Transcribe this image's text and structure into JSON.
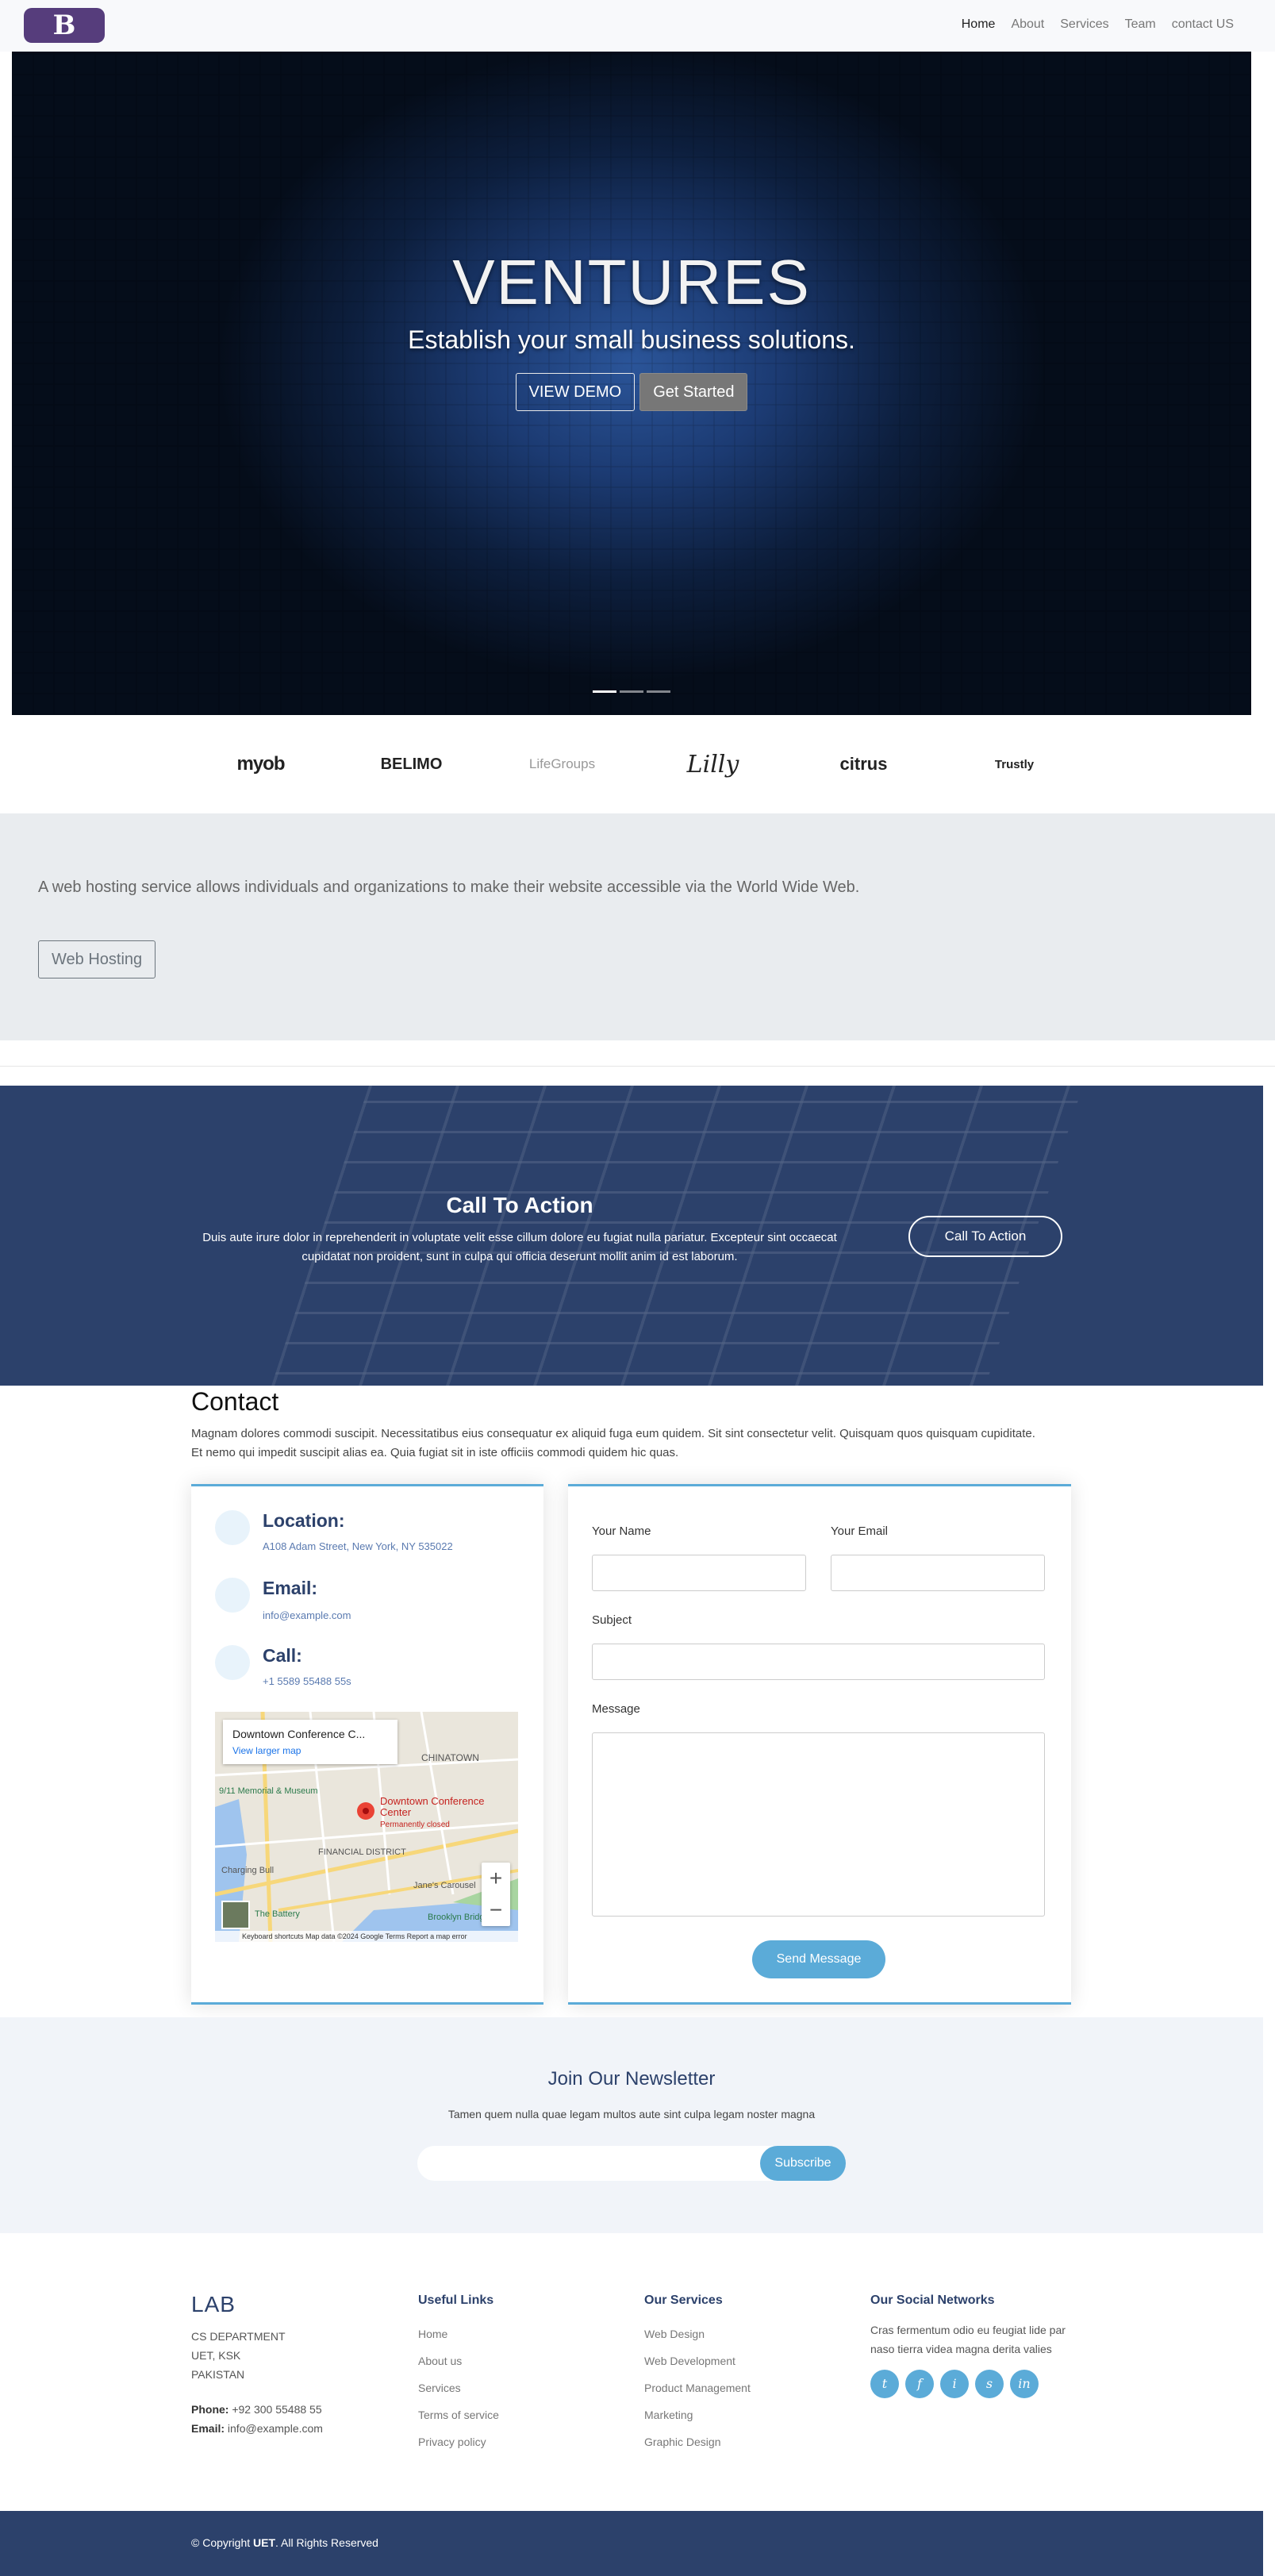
{
  "navbar": {
    "brand_letter": "B",
    "links": [
      "Home",
      "About",
      "Services",
      "Team",
      "contact US"
    ]
  },
  "hero": {
    "title": "VENTURES",
    "subtitle": "Establish your small business solutions.",
    "demo_button": "VIEW DEMO",
    "start_button": "Get Started",
    "slides": 3,
    "active_slide": 1
  },
  "clients": [
    "myob",
    "BELIMO",
    "LifeGroups",
    "Lilly",
    "citrus",
    "Trustly"
  ],
  "hosting": {
    "text": "A web hosting service allows individuals and organizations to make their website accessible via the World Wide Web.",
    "button": "Web Hosting"
  },
  "cta": {
    "title": "Call To Action",
    "text": "Duis aute irure dolor in reprehenderit in voluptate velit esse cillum dolore eu fugiat nulla pariatur. Excepteur sint occaecat cupidatat non proident, sunt in culpa qui officia deserunt mollit anim id est laborum.",
    "button": "Call To Action"
  },
  "contact": {
    "title": "Contact",
    "text": "Magnam dolores commodi suscipit. Necessitatibus eius consequatur ex aliquid fuga eum quidem. Sit sint consectetur velit. Quisquam quos quisquam cupiditate. Et nemo qui impedit suscipit alias ea. Quia fugiat sit in iste officiis commodi quidem hic quas.",
    "location_label": "Location:",
    "location_value": "A108 Adam Street, New York, NY 535022",
    "email_label": "Email:",
    "email_value": "info@example.com",
    "call_label": "Call:",
    "call_value": "+1 5589 55488 55s",
    "map": {
      "place_title": "Downtown Conference C...",
      "larger_map_link": "View larger map",
      "pin_label": "Downtown Conference Center",
      "pin_status": "Permanently closed",
      "area_labels": [
        "CHINATOWN",
        "FINANCIAL DISTRICT",
        "9/11 Memorial & Museum",
        "Charging Bull",
        "The Battery",
        "Jane's Carousel",
        "Brooklyn Bridge Park"
      ],
      "footer": "Keyboard shortcuts   Map data ©2024 Google   Terms   Report a map error",
      "zoom_in": "+",
      "zoom_out": "−"
    },
    "form": {
      "name_label": "Your Name",
      "email_label": "Your Email",
      "subject_label": "Subject",
      "message_label": "Message",
      "send_button": "Send Message"
    }
  },
  "newsletter": {
    "title": "Join Our Newsletter",
    "text": "Tamen quem nulla quae legam multos aute sint culpa legam noster magna",
    "button": "Subscribe"
  },
  "footer": {
    "brand": "LAB",
    "address": [
      "CS DEPARTMENT",
      "UET, KSK",
      "PAKISTAN"
    ],
    "phone_label": "Phone:",
    "phone": "+92 300 55488 55",
    "email_label": "Email:",
    "email": "info@example.com",
    "useful_links_title": "Useful Links",
    "useful_links": [
      "Home",
      "About us",
      "Services",
      "Terms of service",
      "Privacy policy"
    ],
    "services_title": "Our Services",
    "services": [
      "Web Design",
      "Web Development",
      "Product Management",
      "Marketing",
      "Graphic Design"
    ],
    "social_title": "Our Social Networks",
    "social_text": "Cras fermentum odio eu feugiat lide par naso tierra videa magna derita valies",
    "social_icons": [
      "t",
      "f",
      "i",
      "s",
      "in"
    ],
    "copyright_prefix": "© Copyright",
    "copyright_brand": "UET",
    "copyright_suffix": ". All Rights Reserved"
  },
  "colors": {
    "accent": "#5babd8",
    "navy": "#2c416b",
    "brand_purple": "#563d7c"
  }
}
